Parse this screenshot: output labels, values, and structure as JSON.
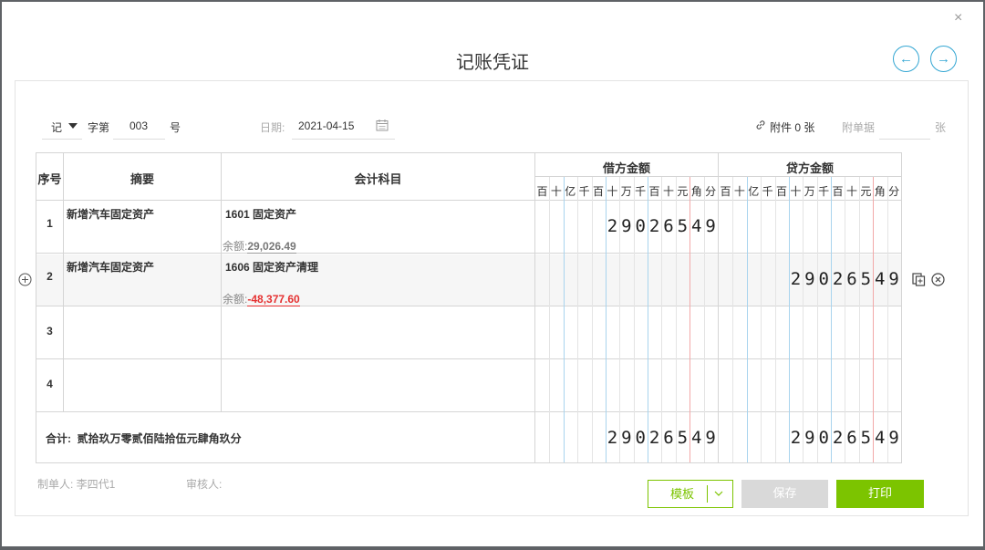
{
  "dialog": {
    "title": "记账凭证",
    "close_glyph": "×",
    "prev_glyph": "←",
    "next_glyph": "→"
  },
  "header": {
    "voucher_type": "记",
    "zi_di": "字第",
    "number": "003",
    "hao": "号",
    "date_label": "日期:",
    "date_value": "2021-04-15",
    "attachment": "附件 0 张",
    "receipt_label": "附单据",
    "zhang": "张"
  },
  "table": {
    "headers": {
      "seq": "序号",
      "summary": "摘要",
      "account": "会计科目",
      "debit": "借方金额",
      "credit": "贷方金额"
    },
    "digit_units": [
      "百",
      "十",
      "亿",
      "千",
      "百",
      "十",
      "万",
      "千",
      "百",
      "十",
      "元",
      "角",
      "分"
    ],
    "rows": [
      {
        "seq": "1",
        "summary": "新增汽车固定资产",
        "account": "1601 固定资产",
        "balance_label": "余额:",
        "balance_value": "29,026.49",
        "debit": "29026549",
        "credit": ""
      },
      {
        "seq": "2",
        "summary": "新增汽车固定资产",
        "account": "1606 固定资产清理",
        "balance_label": "余额:",
        "balance_value": "-48,377.60",
        "debit": "",
        "credit": "29026549"
      },
      {
        "seq": "3",
        "summary": "",
        "account": "",
        "balance_label": "",
        "balance_value": "",
        "debit": "",
        "credit": ""
      },
      {
        "seq": "4",
        "summary": "",
        "account": "",
        "balance_label": "",
        "balance_value": "",
        "debit": "",
        "credit": ""
      }
    ],
    "total": {
      "label": "合计:",
      "words": "贰拾玖万零贰佰陆拾伍元肆角玖分",
      "debit": "29026549",
      "credit": "29026549"
    }
  },
  "footer": {
    "maker": "制单人: 李四代1",
    "reviewer": "审核人:",
    "template_btn": "模板",
    "save_btn": "保存",
    "print_btn": "打印"
  },
  "colors": {
    "accent_green": "#7cc400",
    "nav_blue": "#35a7d3",
    "negative_red": "#e53030"
  }
}
